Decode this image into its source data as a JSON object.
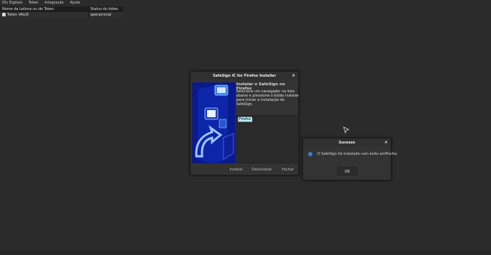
{
  "menu": [
    "IDs Digitais",
    "Token",
    "Integração",
    "Ajuda"
  ],
  "token_table": {
    "columns": [
      "Nome da Leitora ou do Token",
      "Status do token"
    ],
    "rows": [
      {
        "name": "Token VALID",
        "status": "operacional"
      }
    ]
  },
  "installer_dialog": {
    "title": "SafeSign IC for Firefox Installer",
    "heading": "Instalar o SafeSign no Firefox",
    "description": "Selecione um navegador na lista abaixo e pressione o botão Instalar para iniciar a instalação do SafeSign.",
    "browsers": [
      "Firefox"
    ],
    "buttons": {
      "install": "Instalar",
      "uninstall": "Desinstalar",
      "close": "Fechar"
    },
    "close_glyph": "×"
  },
  "success_dialog": {
    "title": "Sucesso",
    "message": "O SafeSign foi instalado com êxito emFirefox",
    "ok": "OK",
    "close_glyph": "×"
  },
  "colors": {
    "background": "#2b2b2b",
    "banner": "#0a1a8c",
    "selection": "#bfefff",
    "info": "#3d7bd9"
  }
}
